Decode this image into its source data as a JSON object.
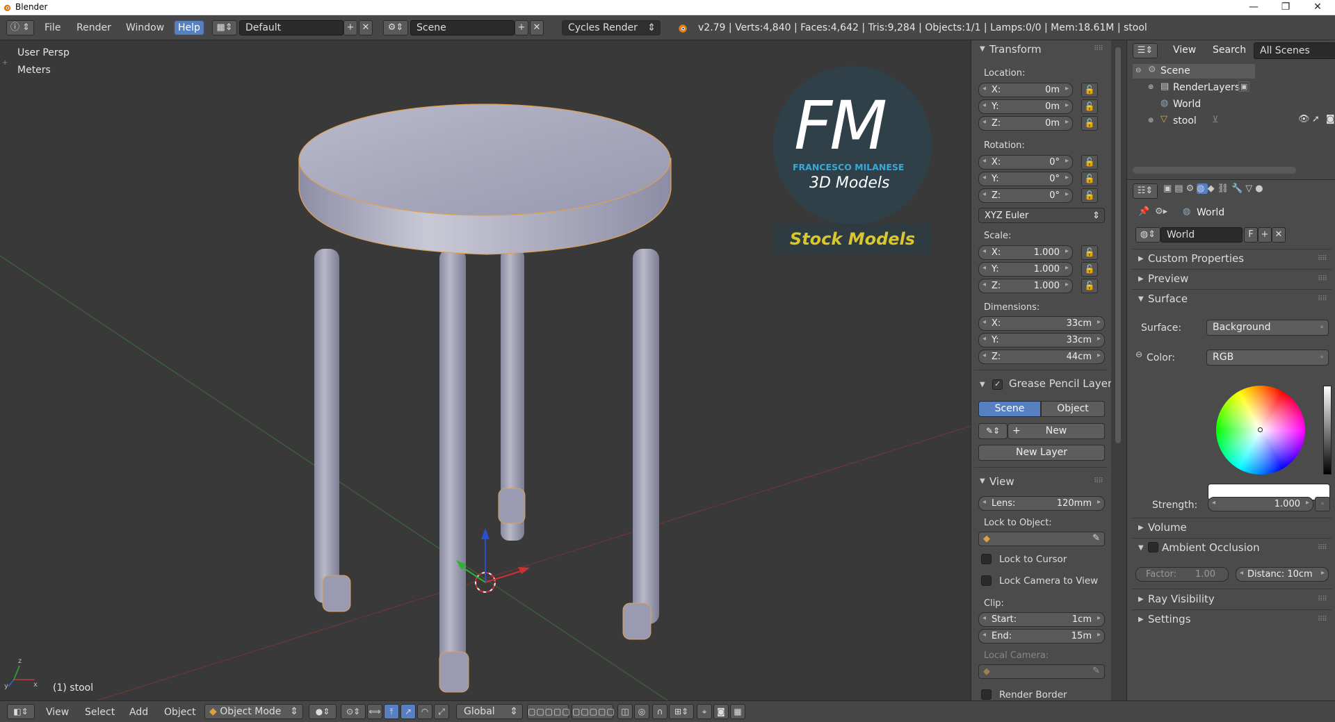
{
  "window": {
    "title": "Blender",
    "controls": [
      "—",
      "❐",
      "✕"
    ]
  },
  "topbar": {
    "menus": [
      "File",
      "Render",
      "Window",
      "Help"
    ],
    "active_menu": "Help",
    "screen_layout": "Default",
    "scene": "Scene",
    "render_engine": "Cycles Render",
    "stats": "v2.79 | Verts:4,840 | Faces:4,642 | Tris:9,284 | Objects:1/1 | Lamps:0/0 | Mem:18.61M | stool"
  },
  "viewport": {
    "view_name": "User Persp",
    "units": "Meters",
    "object_label": "(1) stool",
    "watermark": {
      "monogram": "FM",
      "brand": "FRANCESCO MILANESE",
      "subtitle": "3D Models",
      "banner": "Stock Models"
    }
  },
  "npanel": {
    "transform": {
      "title": "Transform",
      "location_label": "Location:",
      "location": [
        {
          "axis": "X:",
          "value": "0m"
        },
        {
          "axis": "Y:",
          "value": "0m"
        },
        {
          "axis": "Z:",
          "value": "0m"
        }
      ],
      "rotation_label": "Rotation:",
      "rotation": [
        {
          "axis": "X:",
          "value": "0°"
        },
        {
          "axis": "Y:",
          "value": "0°"
        },
        {
          "axis": "Z:",
          "value": "0°"
        }
      ],
      "rotation_mode": "XYZ Euler",
      "scale_label": "Scale:",
      "scale": [
        {
          "axis": "X:",
          "value": "1.000"
        },
        {
          "axis": "Y:",
          "value": "1.000"
        },
        {
          "axis": "Z:",
          "value": "1.000"
        }
      ],
      "dimensions_label": "Dimensions:",
      "dimensions": [
        {
          "axis": "X:",
          "value": "33cm"
        },
        {
          "axis": "Y:",
          "value": "33cm"
        },
        {
          "axis": "Z:",
          "value": "44cm"
        }
      ]
    },
    "grease_pencil": {
      "title": "Grease Pencil Layer",
      "tabs": [
        "Scene",
        "Object"
      ],
      "active_tab": "Scene",
      "new_label": "New",
      "new_layer_label": "New Layer"
    },
    "view": {
      "title": "View",
      "lens_label": "Lens:",
      "lens_value": "120mm",
      "lock_to_object": "Lock to Object:",
      "lock_to_cursor": "Lock to Cursor",
      "lock_camera": "Lock Camera to View",
      "clip_label": "Clip:",
      "clip_start_label": "Start:",
      "clip_start": "1cm",
      "clip_end_label": "End:",
      "clip_end": "15m",
      "local_camera": "Local Camera:",
      "render_border": "Render Border"
    }
  },
  "outliner": {
    "menus": [
      "View",
      "Search"
    ],
    "filter": "All Scenes",
    "items": [
      {
        "label": "Scene",
        "icon": "scene-icon"
      },
      {
        "label": "RenderLayers",
        "icon": "renderlayers-icon"
      },
      {
        "label": "World",
        "icon": "world-icon"
      },
      {
        "label": "stool",
        "icon": "object-icon"
      }
    ]
  },
  "properties": {
    "breadcrumb": "World",
    "datablock": "World",
    "fake_user": "F",
    "sections": {
      "custom_properties": "Custom Properties",
      "preview": "Preview",
      "surface": "Surface",
      "volume": "Volume",
      "ambient_occlusion": "Ambient Occlusion",
      "ray_visibility": "Ray Visibility",
      "settings": "Settings"
    },
    "surface_label": "Surface:",
    "surface_value": "Background",
    "color_label": "Color:",
    "color_mode": "RGB",
    "strength_label": "Strength:",
    "strength_value": "1.000",
    "ao_factor_label": "Factor:",
    "ao_factor_value": "1.00",
    "ao_distance": "Distanc: 10cm"
  },
  "bottombar": {
    "menus": [
      "View",
      "Select",
      "Add",
      "Object"
    ],
    "mode": "Object Mode",
    "orientation": "Global"
  },
  "colors": {
    "accent": "#5680c2",
    "selection_outline": "#f0a040",
    "viewport_bg": "#393939"
  }
}
